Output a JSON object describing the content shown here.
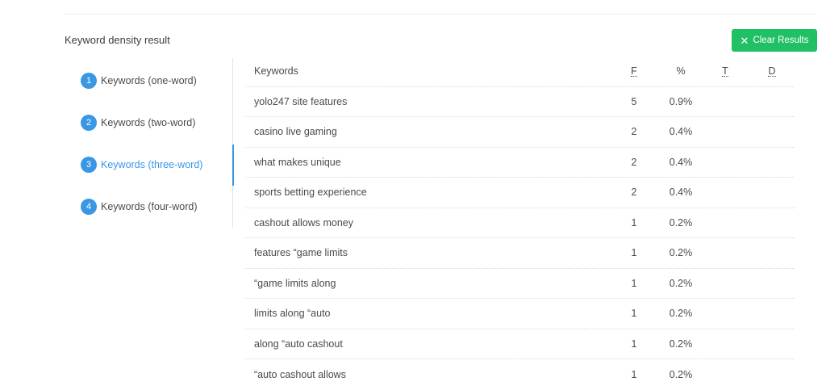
{
  "section": {
    "title": "Keyword density result",
    "clear_button_label": "Clear Results",
    "clear_button_icon": "close-icon",
    "accent_color": "#3a97e4",
    "button_color": "#22c064"
  },
  "sidebar": {
    "items": [
      {
        "number": "1",
        "label": "Keywords (one-word)",
        "active": false
      },
      {
        "number": "2",
        "label": "Keywords (two-word)",
        "active": false
      },
      {
        "number": "3",
        "label": "Keywords (three-word)",
        "active": true
      },
      {
        "number": "4",
        "label": "Keywords (four-word)",
        "active": false
      }
    ]
  },
  "table": {
    "headers": {
      "keyword": "Keywords",
      "f": "F",
      "percent": "%",
      "t": "T",
      "d": "D"
    },
    "rows": [
      {
        "keyword": "yolo247 site features",
        "f": "5",
        "percent": "0.9%"
      },
      {
        "keyword": "casino live gaming",
        "f": "2",
        "percent": "0.4%"
      },
      {
        "keyword": "what makes unique",
        "f": "2",
        "percent": "0.4%"
      },
      {
        "keyword": "sports betting experience",
        "f": "2",
        "percent": "0.4%"
      },
      {
        "keyword": "cashout allows money",
        "f": "1",
        "percent": "0.2%"
      },
      {
        "keyword": "features “game limits",
        "f": "1",
        "percent": "0.2%"
      },
      {
        "keyword": "“game limits along",
        "f": "1",
        "percent": "0.2%"
      },
      {
        "keyword": "limits along “auto",
        "f": "1",
        "percent": "0.2%"
      },
      {
        "keyword": "along “auto cashout",
        "f": "1",
        "percent": "0.2%"
      },
      {
        "keyword": "“auto cashout allows",
        "f": "1",
        "percent": "0.2%"
      }
    ]
  }
}
